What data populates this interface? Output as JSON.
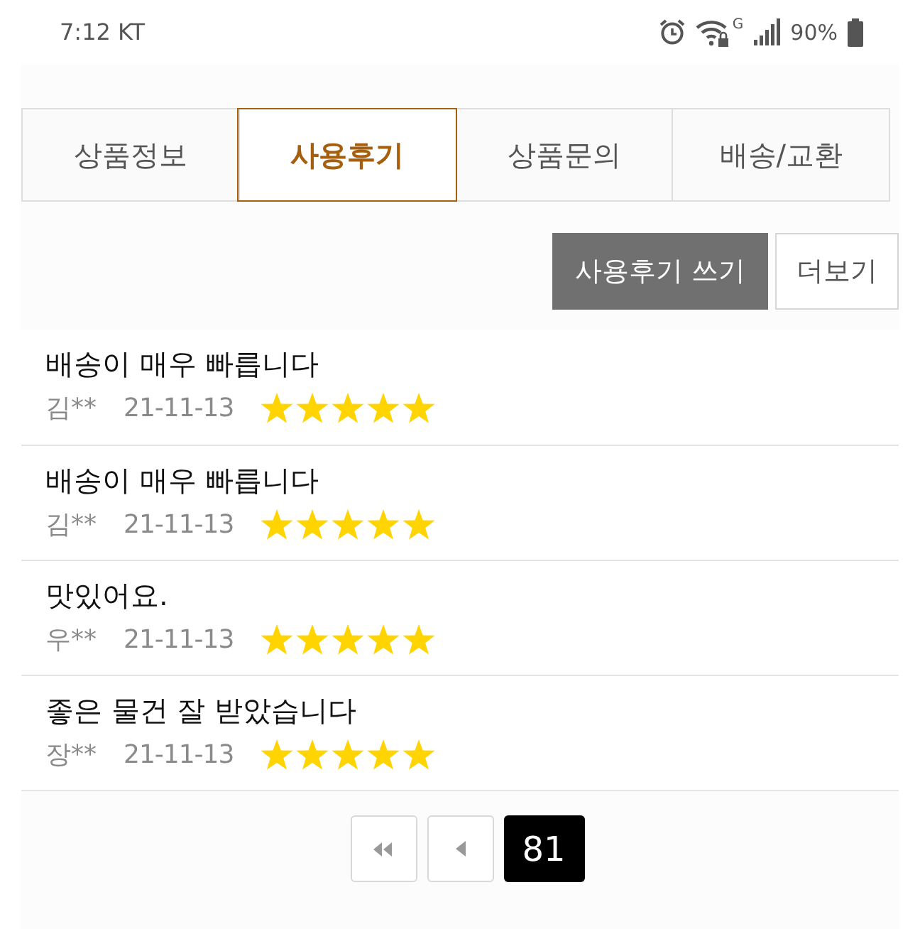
{
  "status_bar": {
    "time": "7:12",
    "carrier": "KT",
    "network_badge": "G",
    "battery_text": "90%"
  },
  "tabs": [
    {
      "label": "상품정보",
      "selected": false
    },
    {
      "label": "사용후기",
      "selected": true
    },
    {
      "label": "상품문의",
      "selected": false
    },
    {
      "label": "배송/교환",
      "selected": false
    }
  ],
  "actions": [
    {
      "label": "사용후기 쓰기",
      "kind": "primary"
    },
    {
      "label": "더보기",
      "kind": "secondary"
    }
  ],
  "reviews": [
    {
      "title": "배송이 매우 빠릅니다",
      "author": "김**",
      "date": "21-11-13",
      "stars": 5
    },
    {
      "title": "배송이 매우 빠릅니다",
      "author": "김**",
      "date": "21-11-13",
      "stars": 5
    },
    {
      "title": "맛있어요.",
      "author": "우**",
      "date": "21-11-13",
      "stars": 5
    },
    {
      "title": "좋은 물건 잘 받았습니다",
      "author": "장**",
      "date": "21-11-13",
      "stars": 5
    }
  ],
  "pagination": {
    "pages": [
      {
        "label": "81",
        "selected": true
      }
    ]
  }
}
